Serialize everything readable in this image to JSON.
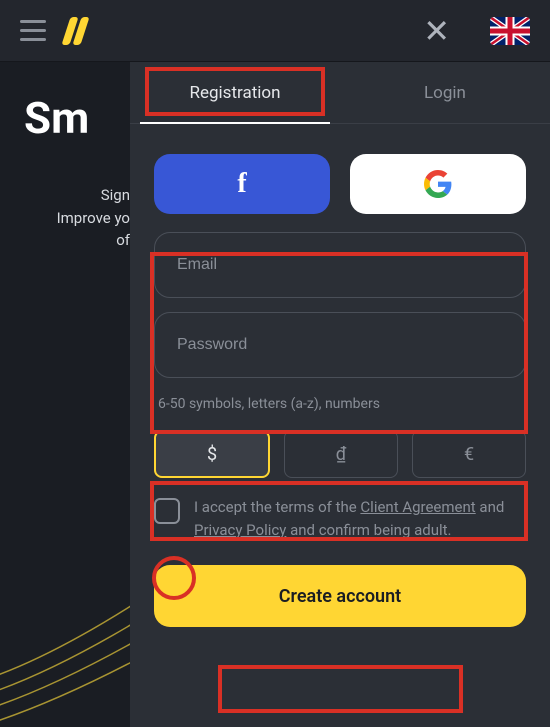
{
  "topbar": {
    "close_label": "✕",
    "language": "en-GB"
  },
  "background": {
    "title": "Sm",
    "line1": "Sign",
    "line2": "Improve yo",
    "line3": "of"
  },
  "tabs": {
    "registration": "Registration",
    "login": "Login",
    "active": "registration"
  },
  "social": {
    "facebook_label": "f",
    "google_label": "G"
  },
  "form": {
    "email_placeholder": "Email",
    "email_value": "",
    "password_placeholder": "Password",
    "password_value": "",
    "hint": "6-50 symbols, letters (a-z), numbers"
  },
  "currencies": {
    "options": [
      "$",
      "₫",
      "€"
    ],
    "selected": "$"
  },
  "terms": {
    "checked": false,
    "prefix": "I accept the terms of the ",
    "link1": "Client Agreement",
    "mid": " and ",
    "link2": "Privacy Policy",
    "suffix": " and confirm being adult."
  },
  "submit": {
    "label": "Create account"
  },
  "colors": {
    "accent": "#ffd633",
    "facebook": "#3857d6",
    "highlight": "#d93025"
  }
}
